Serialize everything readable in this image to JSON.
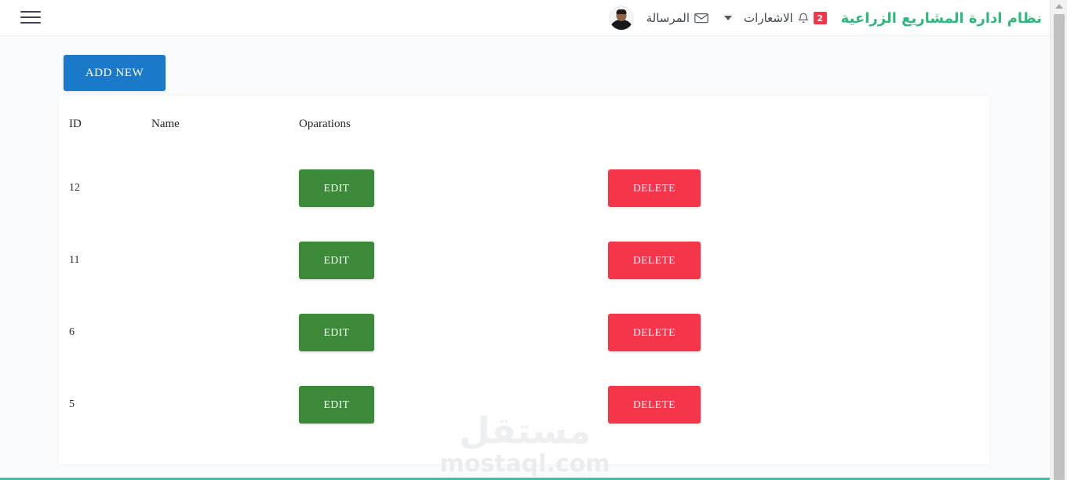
{
  "navbar": {
    "menu_icon": "hamburger-icon",
    "brand_title": "نظام ادارة المشاريع الزراعية",
    "notifications": {
      "label": "الاشعارات",
      "icon": "bell-icon",
      "badge_count": "2"
    },
    "dropdown_icon": "chevron-down-icon",
    "messages": {
      "label": "المرسالة",
      "icon": "envelope-icon"
    },
    "avatar": "user-avatar"
  },
  "toolbar": {
    "add_new_label": "ADD NEW"
  },
  "table": {
    "headers": [
      "ID",
      "Name",
      "Oparations"
    ],
    "rows": [
      {
        "id": "12",
        "name": "",
        "edit_label": "EDIT",
        "delete_label": "DELETE"
      },
      {
        "id": "11",
        "name": "",
        "edit_label": "EDIT",
        "delete_label": "DELETE"
      },
      {
        "id": "6",
        "name": "",
        "edit_label": "EDIT",
        "delete_label": "DELETE"
      },
      {
        "id": "5",
        "name": "",
        "edit_label": "EDIT",
        "delete_label": "DELETE"
      }
    ]
  },
  "watermark": {
    "arabic": "مستقل",
    "latin": "mostaql.com"
  },
  "colors": {
    "brand_green": "#2eb87c",
    "add_new_blue": "#1a7ac9",
    "edit_green": "#3c8a39",
    "delete_red": "#f5364a",
    "badge_red": "#f4354a",
    "bottom_rule_teal": "#3fbfa4"
  },
  "scrollbar": {
    "up_arrow_icon": "scroll-up-arrow-icon"
  }
}
